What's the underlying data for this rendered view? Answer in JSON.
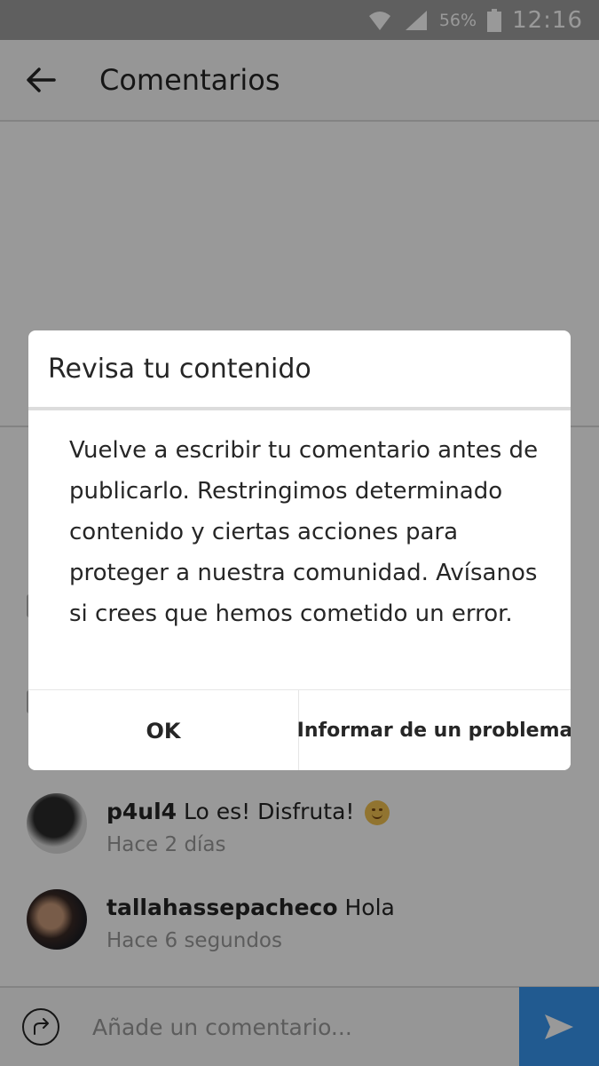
{
  "status_bar": {
    "battery_percent": "56%",
    "time": "12:16",
    "icons": [
      "wifi-icon",
      "signal-icon",
      "battery-icon"
    ]
  },
  "header": {
    "title": "Comentarios",
    "back_icon": "arrow-left-icon"
  },
  "comments": [
    {
      "user": "p4ul4",
      "text": "Lo es! Disfruta!",
      "emoji": "smiling-face",
      "time": "Hace 2 días"
    },
    {
      "user": "tallahassepacheco",
      "text": "Hola",
      "time": "Hace 6 segundos"
    }
  ],
  "input_bar": {
    "placeholder": "Añade un comentario...",
    "share_icon": "share-icon",
    "send_icon": "send-icon"
  },
  "dialog": {
    "title": "Revisa tu contenido",
    "message": "Vuelve a escribir tu comentario antes de publicarlo. Restringimos determinado contenido y ciertas acciones para proteger a nuestra comunidad. Avísanos si crees que hemos cometido un error.",
    "ok_label": "OK",
    "report_label": "Informar de un problema"
  },
  "colors": {
    "accent": "#3897f0",
    "overlay": "rgba(0,0,0,0.4)",
    "secondary_text": "#999999"
  }
}
